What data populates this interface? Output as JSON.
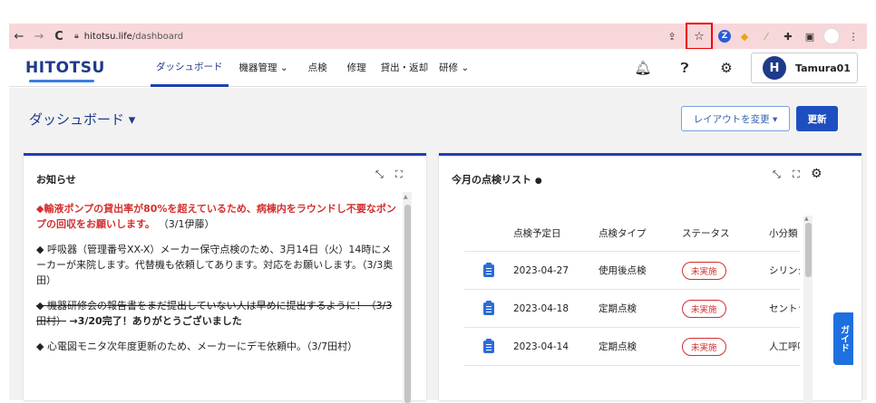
{
  "browser": {
    "back": "←",
    "forward": "→",
    "reload": "C",
    "url_domain": "hitotsu.life",
    "url_path": "/dashboard",
    "ext_z": "Z"
  },
  "header": {
    "logo": "HITOTSU",
    "nav": [
      {
        "label": "ダッシュボード"
      },
      {
        "label": "機器管理 ⌄"
      },
      {
        "label": "点検"
      },
      {
        "label": "修理"
      },
      {
        "label": "貸出・返却"
      },
      {
        "label": "研修 ⌄"
      }
    ],
    "user_initial": "H",
    "user_name": "Tamura01"
  },
  "page": {
    "title": "ダッシュボード ▾",
    "layout_button": "レイアウトを変更 ▾",
    "refresh_button": "更新"
  },
  "news": {
    "title": "お知らせ",
    "items": [
      {
        "text": "◆輸液ポンプの貸出率が80%を超えているため、病棟内をラウンドし不要なポンプの回収をお願いします。",
        "suffix": "（3/1伊藤）"
      },
      {
        "text": "◆ 呼吸器（管理番号XX-X）メーカー保守点検のため、3月14日（火）14時にメーカーが来院します。代替機も依頼してあります。対応をお願いします。（3/3奥田）"
      },
      {
        "strike": "◆ 機器研修会の報告書をまだ提出していない人は早めに提出するように！（3/3田村）",
        "bold": "→3/20完了！ありがとうございました"
      },
      {
        "text": "◆ 心電図モニタ次年度更新のため、メーカーにデモ依頼中。（3/7田村）"
      }
    ]
  },
  "inspection": {
    "title": "今月の点検リスト",
    "info_icon": "●",
    "columns": {
      "date": "点検予定日",
      "type": "点検タイプ",
      "status": "ステータス",
      "category": "小分類"
    },
    "rows": [
      {
        "date": "2023-04-27",
        "type": "使用後点検",
        "status": "未実施",
        "category": "シリンジ"
      },
      {
        "date": "2023-04-18",
        "type": "定期点検",
        "status": "未実施",
        "category": "セントラ"
      },
      {
        "date": "2023-04-14",
        "type": "定期点検",
        "status": "未実施",
        "category": "人工呼吸"
      }
    ]
  },
  "guide": {
    "label": "ガイド"
  },
  "colors": {
    "brand": "#1e3a8a",
    "accent": "#1e40af",
    "alert": "#d32f2f",
    "browser_bar": "#f8d7da"
  }
}
